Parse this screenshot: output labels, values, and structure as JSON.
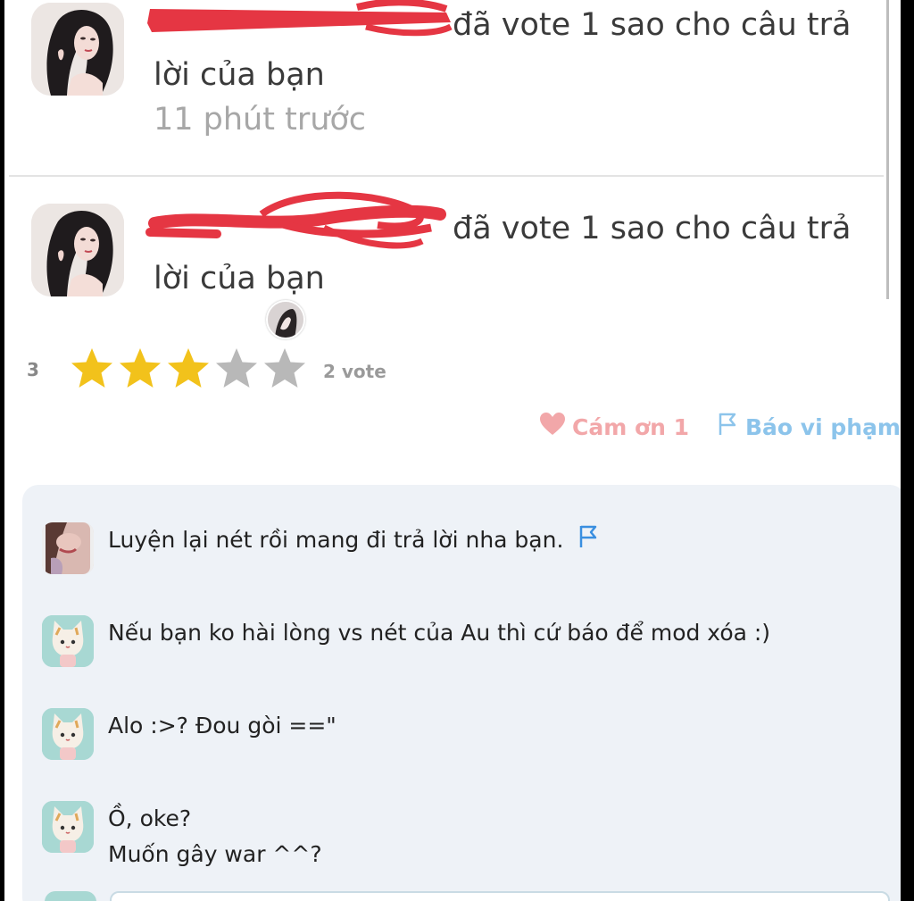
{
  "notifications": [
    {
      "text_line1": "đã vote 1 sao cho câu trả",
      "text_line2": "lời của bạn",
      "time": "11 phút trước"
    },
    {
      "text_line1": "đã vote 1 sao cho câu trả",
      "text_line2": "lời của bạn"
    }
  ],
  "rating": {
    "score": "3",
    "stars_filled": 3,
    "stars_total": 5,
    "votes": "2 vote",
    "star_color": "#f2c21b",
    "star_empty_color": "#b8b8b8"
  },
  "actions": {
    "thanks_label": "Cám ơn 1",
    "report_label": "Báo vi phạm"
  },
  "comments": [
    {
      "text": "Luyện lại nét rồi mang đi trả lời nha bạn."
    },
    {
      "text": "Nếu bạn ko hài lòng vs nét của Au thì cứ báo để mod xóa :)"
    },
    {
      "text": "Alo :>? Đou gòi ==\""
    },
    {
      "text_line1": "Ồ, oke?",
      "text_line2": "Muốn gây war ^^?"
    }
  ],
  "colors": {
    "redaction": "#e53643",
    "thanks": "#f2a7a9",
    "report": "#8cc4eb",
    "comment_bg": "#eef2f7"
  }
}
